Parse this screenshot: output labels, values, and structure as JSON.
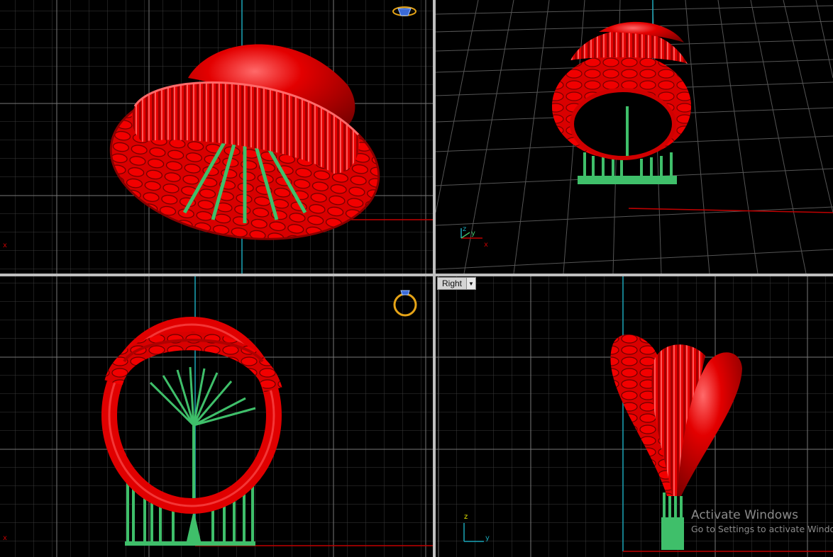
{
  "viewports": {
    "right_view_label": "Right",
    "right_view_dropdown_arrow": "▼"
  },
  "axes": {
    "x": "x",
    "y": "y",
    "z": "z"
  },
  "watermark": {
    "title": "Activate Windows",
    "subtitle": "Go to Settings to activate Windows."
  },
  "icons": {
    "top_viewport_gem": "gem-icon",
    "front_viewport_ring": "ring-icon"
  },
  "colors": {
    "model_red": "#e00000",
    "support_green": "#3fbf6a",
    "grid_minor": "#3a3a3a",
    "grid_major": "#7a7a7a",
    "axis_red": "#c00000",
    "axis_cyan": "#1aa6b7",
    "divider": "#bfbfbf",
    "icon_gold": "#e6a417"
  }
}
